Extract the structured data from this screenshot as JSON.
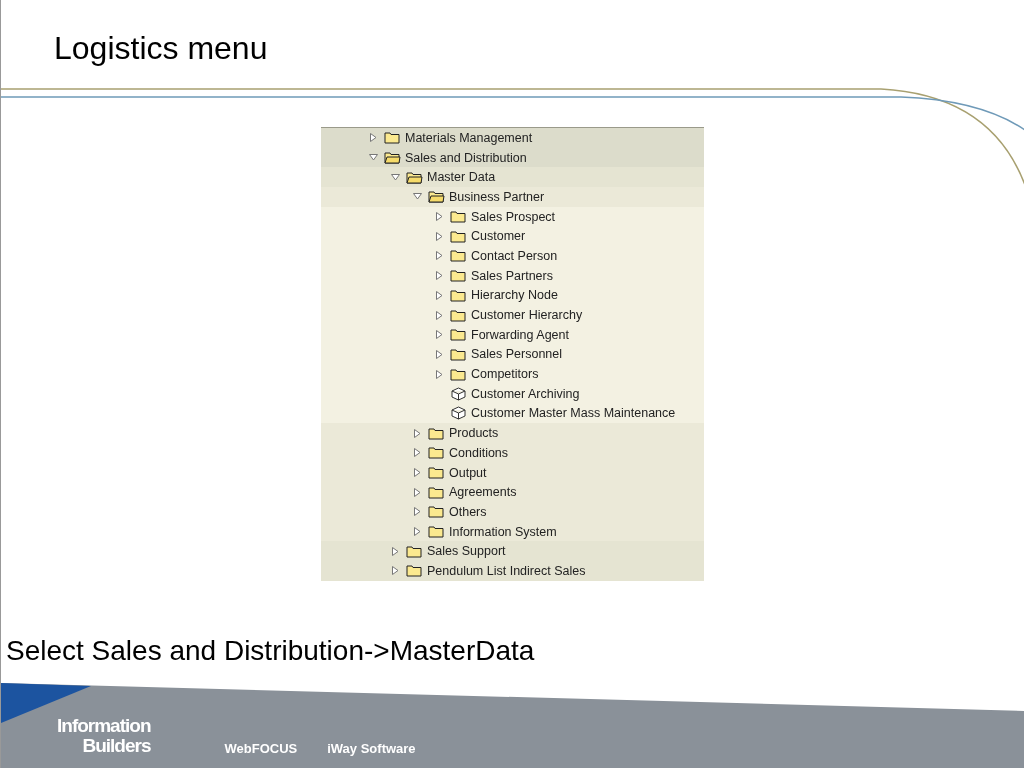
{
  "slide": {
    "title": "Logistics menu",
    "caption": "Select Sales and Distribution->MasterData"
  },
  "tree": [
    {
      "label": "Materials Management",
      "kind": "folder",
      "expanded": false
    },
    {
      "label": "Sales and Distribution",
      "kind": "folder",
      "expanded": true,
      "children": [
        {
          "label": "Master Data",
          "kind": "folder",
          "expanded": true,
          "children": [
            {
              "label": "Business Partner",
              "kind": "folder",
              "expanded": true,
              "children": [
                {
                  "label": "Sales Prospect",
                  "kind": "folder",
                  "expanded": false
                },
                {
                  "label": "Customer",
                  "kind": "folder",
                  "expanded": false
                },
                {
                  "label": "Contact Person",
                  "kind": "folder",
                  "expanded": false
                },
                {
                  "label": "Sales Partners",
                  "kind": "folder",
                  "expanded": false
                },
                {
                  "label": "Hierarchy Node",
                  "kind": "folder",
                  "expanded": false
                },
                {
                  "label": "Customer Hierarchy",
                  "kind": "folder",
                  "expanded": false
                },
                {
                  "label": "Forwarding Agent",
                  "kind": "folder",
                  "expanded": false
                },
                {
                  "label": "Sales Personnel",
                  "kind": "folder",
                  "expanded": false
                },
                {
                  "label": "Competitors",
                  "kind": "folder",
                  "expanded": false
                },
                {
                  "label": "Customer Archiving",
                  "kind": "transaction"
                },
                {
                  "label": "Customer Master Mass Maintenance",
                  "kind": "transaction"
                }
              ]
            },
            {
              "label": "Products",
              "kind": "folder",
              "expanded": false
            },
            {
              "label": "Conditions",
              "kind": "folder",
              "expanded": false
            },
            {
              "label": "Output",
              "kind": "folder",
              "expanded": false
            },
            {
              "label": "Agreements",
              "kind": "folder",
              "expanded": false
            },
            {
              "label": "Others",
              "kind": "folder",
              "expanded": false
            },
            {
              "label": "Information System",
              "kind": "folder",
              "expanded": false
            }
          ]
        },
        {
          "label": "Sales Support",
          "kind": "folder",
          "expanded": false
        },
        {
          "label": "Pendulum List Indirect Sales",
          "kind": "folder",
          "expanded": false
        }
      ]
    }
  ],
  "footer": {
    "logo_line_1": "Information",
    "logo_line_2": "Builders",
    "products": [
      "WebFOCUS",
      "iWay Software"
    ]
  }
}
